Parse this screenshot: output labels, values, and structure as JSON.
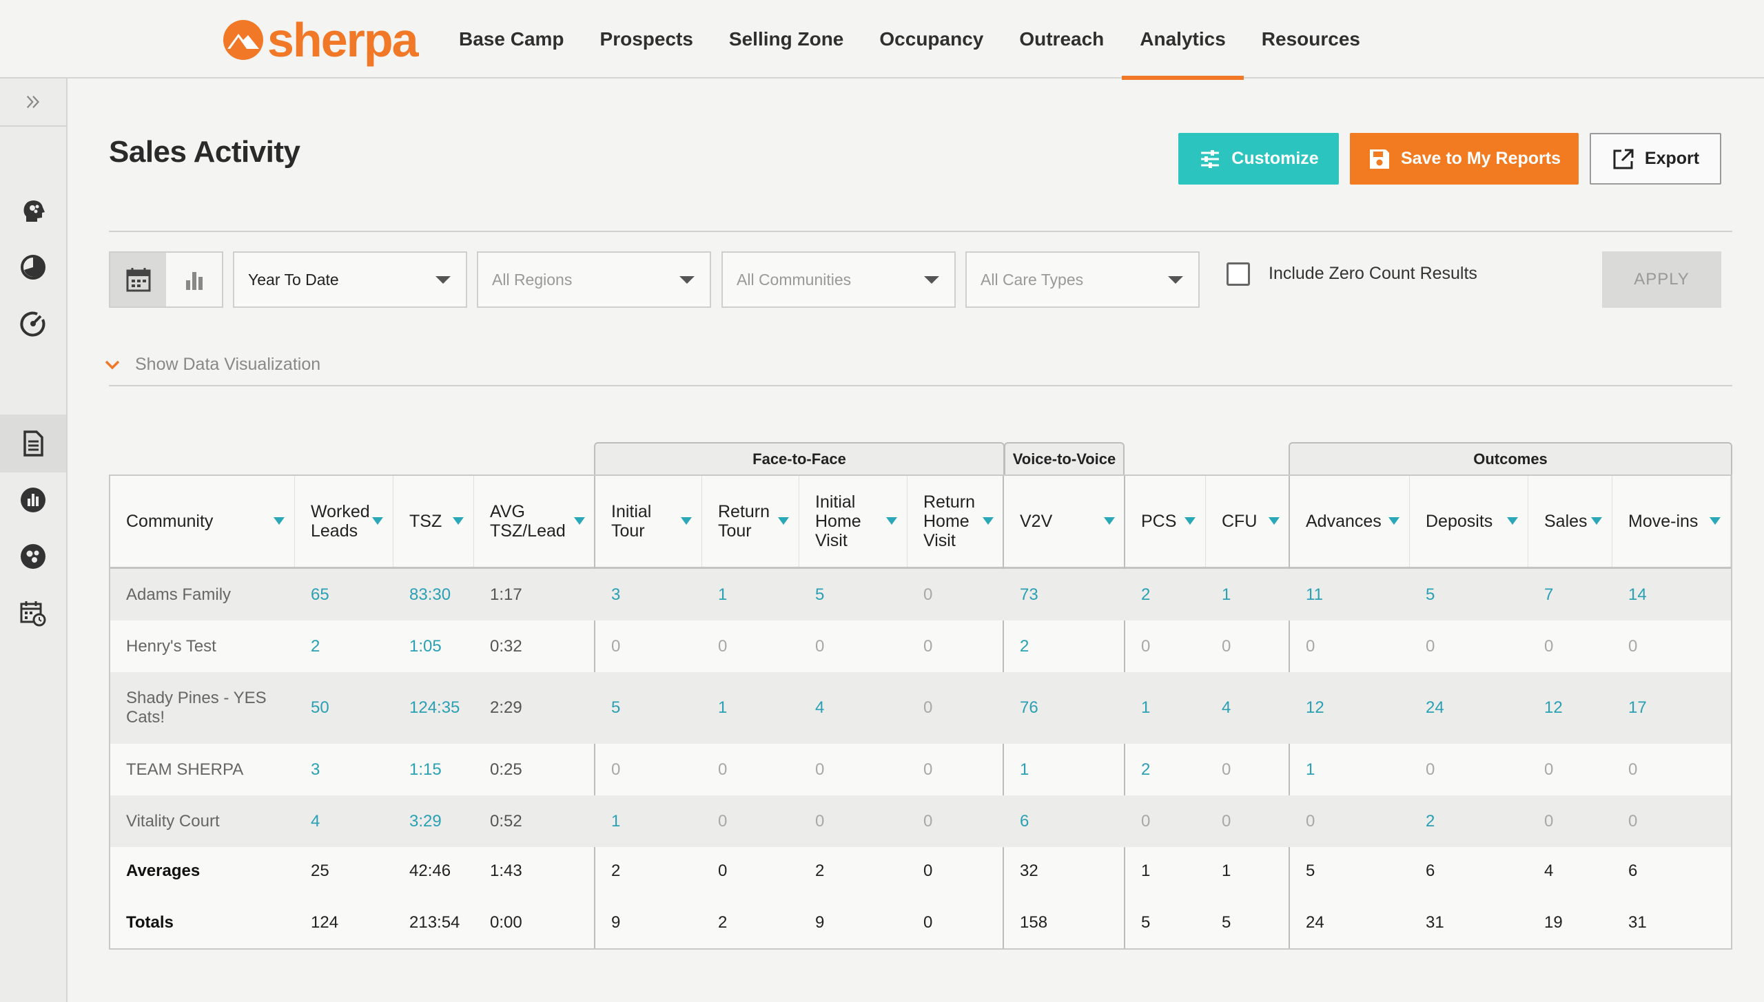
{
  "brand": {
    "name": "sherpa",
    "accent": "#f07826",
    "teal": "#2cc4bf"
  },
  "nav": [
    {
      "label": "Base Camp"
    },
    {
      "label": "Prospects"
    },
    {
      "label": "Selling Zone"
    },
    {
      "label": "Occupancy"
    },
    {
      "label": "Outreach"
    },
    {
      "label": "Analytics",
      "active": true
    },
    {
      "label": "Resources"
    }
  ],
  "sidebar": {
    "toggle_icon": "double-chevron-right-icon",
    "items": [
      {
        "icon": "head-brain-icon"
      },
      {
        "icon": "pie-chart-icon"
      },
      {
        "icon": "gauge-icon"
      },
      {
        "icon": "document-icon",
        "active": true
      },
      {
        "icon": "bar-chart-icon"
      },
      {
        "icon": "brain-icon"
      },
      {
        "icon": "calendar-clock-icon"
      }
    ]
  },
  "page": {
    "title": "Sales Activity"
  },
  "actions": {
    "customize": "Customize",
    "save": "Save to My Reports",
    "export": "Export"
  },
  "filters": {
    "period": "Year To Date",
    "regions": "All Regions",
    "communities": "All Communities",
    "care_types": "All Care Types",
    "include_zero": "Include Zero Count Results",
    "include_zero_checked": false,
    "apply": "APPLY"
  },
  "viz_toggle": "Show Data Visualization",
  "table": {
    "groups": {
      "f2f": "Face-to-Face",
      "v2v": "Voice-to-Voice",
      "outcomes": "Outcomes"
    },
    "columns": [
      "Community",
      "Worked Leads",
      "TSZ",
      "AVG TSZ/Lead",
      "Initial Tour",
      "Return Tour",
      "Initial Home Visit",
      "Return Home Visit",
      "V2V",
      "PCS",
      "CFU",
      "Advances",
      "Deposits",
      "Sales",
      "Move-ins"
    ],
    "rows": [
      [
        "Adams Family",
        "65",
        "83:30",
        "1:17",
        "3",
        "1",
        "5",
        "0",
        "73",
        "2",
        "1",
        "11",
        "5",
        "7",
        "14"
      ],
      [
        "Henry's Test",
        "2",
        "1:05",
        "0:32",
        "0",
        "0",
        "0",
        "0",
        "2",
        "0",
        "0",
        "0",
        "0",
        "0",
        "0"
      ],
      [
        "Shady Pines - YES Cats!",
        "50",
        "124:35",
        "2:29",
        "5",
        "1",
        "4",
        "0",
        "76",
        "1",
        "4",
        "12",
        "24",
        "12",
        "17"
      ],
      [
        "TEAM SHERPA",
        "3",
        "1:15",
        "0:25",
        "0",
        "0",
        "0",
        "0",
        "1",
        "2",
        "0",
        "1",
        "0",
        "0",
        "0"
      ],
      [
        "Vitality Court",
        "4",
        "3:29",
        "0:52",
        "1",
        "0",
        "0",
        "0",
        "6",
        "0",
        "0",
        "0",
        "2",
        "0",
        "0"
      ]
    ],
    "averages": [
      "Averages",
      "25",
      "42:46",
      "1:43",
      "2",
      "0",
      "2",
      "0",
      "32",
      "1",
      "1",
      "5",
      "6",
      "4",
      "6"
    ],
    "totals": [
      "Totals",
      "124",
      "213:54",
      "0:00",
      "9",
      "2",
      "9",
      "0",
      "158",
      "5",
      "5",
      "24",
      "31",
      "19",
      "31"
    ]
  }
}
